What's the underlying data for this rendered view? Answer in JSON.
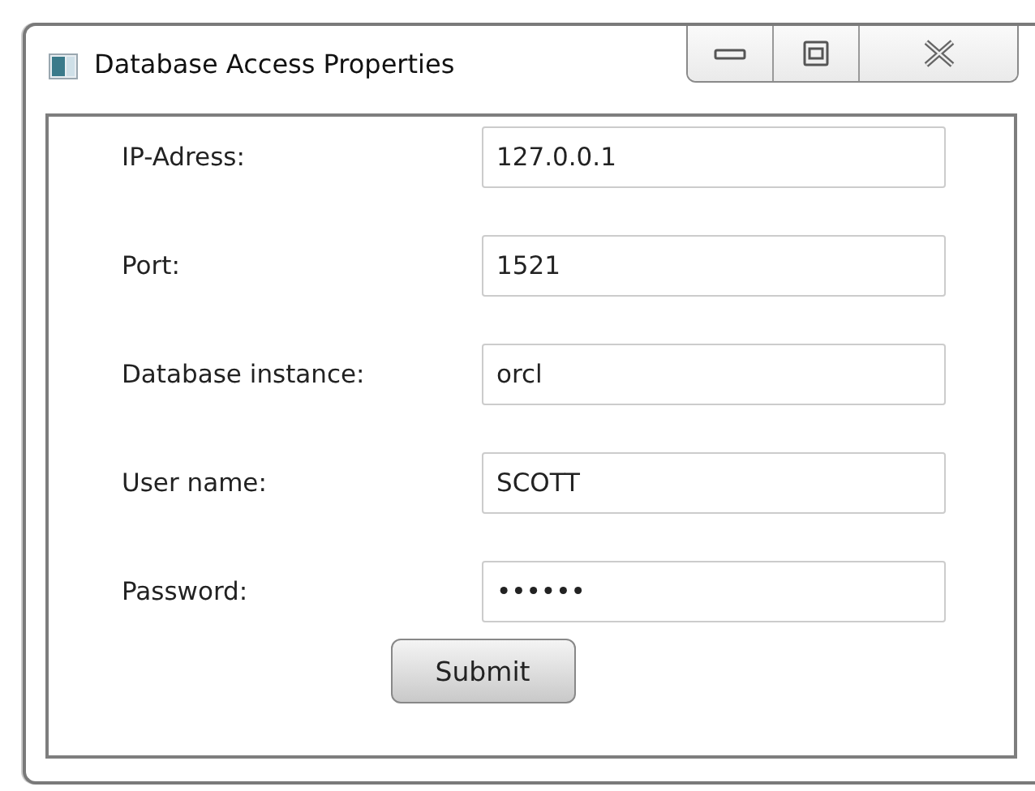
{
  "window": {
    "title": "Database Access Properties"
  },
  "fields": [
    {
      "label": "IP-Adress:",
      "value": "127.0.0.1"
    },
    {
      "label": "Port:",
      "value": "1521"
    },
    {
      "label": "Database instance:",
      "value": "orcl"
    },
    {
      "label": "User name:",
      "value": "SCOTT"
    },
    {
      "label": "Password:",
      "value": "••••••"
    }
  ],
  "buttons": [
    "Submit"
  ]
}
